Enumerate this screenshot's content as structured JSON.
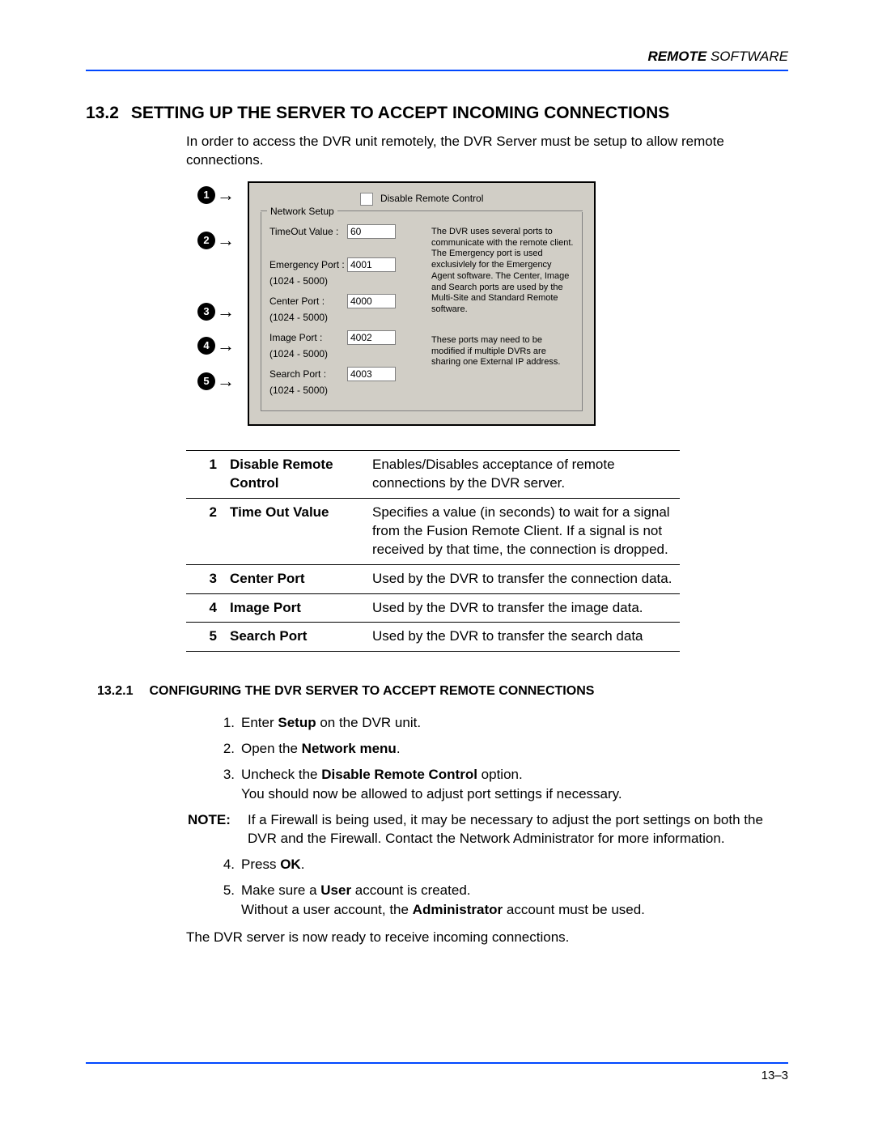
{
  "header": {
    "boldpart": "REMOTE",
    "rest": " SOFTWARE"
  },
  "section": {
    "number": "13.2",
    "title": "SETTING UP THE SERVER TO ACCEPT INCOMING CONNECTIONS"
  },
  "intro": "In order to access the DVR unit remotely, the DVR Server must be setup to allow remote connections.",
  "panel": {
    "disable_label": "Disable Remote Control",
    "group_title": "Network Setup",
    "timeout_label": "TimeOut Value :",
    "timeout_value": "60",
    "emergency_label": "Emergency Port :",
    "emergency_value": "4001",
    "center_label": "Center Port :",
    "center_value": "4000",
    "image_label": "Image Port :",
    "image_value": "4002",
    "search_label": "Search Port :",
    "search_value": "4003",
    "port_range": "(1024 - 5000)",
    "info1": "The DVR uses several ports to communicate with the remote client. The Emergency port is used exclusivlely for the Emergency Agent software. The Center, Image and Search ports are used by the Multi-Site and Standard Remote software.",
    "info2": "These ports may need to be modified if multiple DVRs are sharing one External IP address."
  },
  "callouts": {
    "c1": "1",
    "c2": "2",
    "c3": "3",
    "c4": "4",
    "c5": "5"
  },
  "desc": {
    "r1": {
      "num": "1",
      "name": "Disable Remote Control",
      "text": "Enables/Disables acceptance of remote connections by the DVR server."
    },
    "r2": {
      "num": "2",
      "name": "Time Out Value",
      "text": "Specifies a value (in seconds) to wait for a signal from the Fusion Remote Client. If a signal is not received by that time, the connection is dropped."
    },
    "r3": {
      "num": "3",
      "name": "Center Port",
      "text": "Used by the DVR to transfer the connection data."
    },
    "r4": {
      "num": "4",
      "name": "Image Port",
      "text": "Used by the DVR to transfer the image data."
    },
    "r5": {
      "num": "5",
      "name": "Search Port",
      "text": "Used by the DVR to transfer the search data"
    }
  },
  "subsection": {
    "number": "13.2.1",
    "title": "CONFIGURING THE DVR SERVER TO ACCEPT REMOTE CONNECTIONS"
  },
  "steps": {
    "s1n": "1.",
    "s1a": "Enter ",
    "s1b": "Setup",
    "s1c": " on the DVR unit.",
    "s2n": "2.",
    "s2a": "Open the ",
    "s2b": "Network menu",
    "s2c": ".",
    "s3n": "3.",
    "s3a": "Uncheck the ",
    "s3b": "Disable Remote Control",
    "s3c": " option.",
    "s3d": "You should now be allowed to adjust port settings if necessary.",
    "noteLabel": "NOTE:",
    "noteText": "If a Firewall is being used, it may be necessary to adjust the port settings on both the DVR and the Firewall. Contact the Network Administrator for more information.",
    "s4n": "4.",
    "s4a": "Press ",
    "s4b": "OK",
    "s4c": ".",
    "s5n": "5.",
    "s5a": "Make sure a ",
    "s5b": "User",
    "s5c": " account is created.",
    "s5d1": "Without a user account, the ",
    "s5d2": "Administrator",
    "s5d3": " account must be used."
  },
  "final": "The DVR server is now ready to receive incoming connections.",
  "footer": "13–3"
}
